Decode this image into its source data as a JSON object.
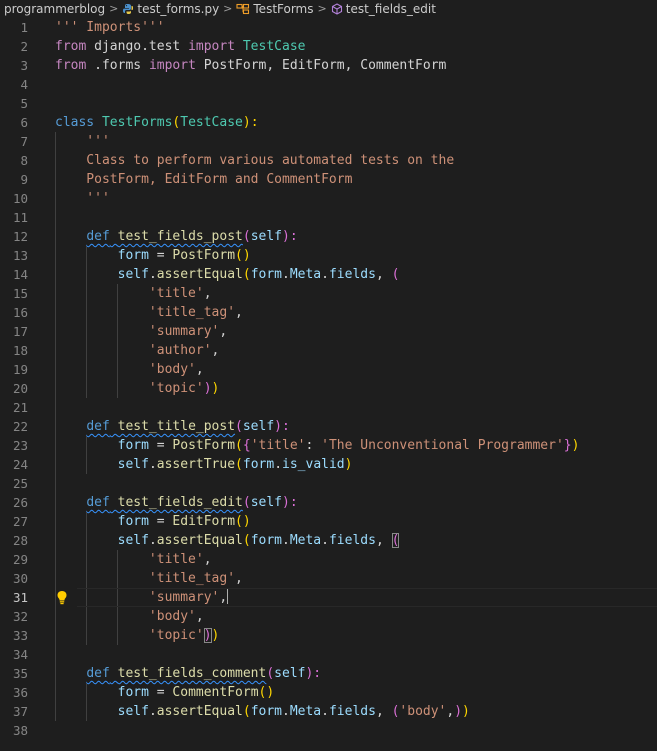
{
  "breadcrumb": {
    "folder": "programmerblog",
    "file": "test_forms.py",
    "class_name": "TestForms",
    "method_name": "test_fields_edit"
  },
  "editor": {
    "active_line": 31,
    "lines": [
      {
        "n": "1",
        "t": [
          {
            "s": "''' Imports'''",
            "c": "str"
          }
        ]
      },
      {
        "n": "2",
        "t": [
          {
            "s": "from",
            "c": "ctrl"
          },
          {
            "s": " django.test ",
            "c": "plain"
          },
          {
            "s": "import",
            "c": "ctrl"
          },
          {
            "s": " ",
            "c": "plain"
          },
          {
            "s": "TestCase",
            "c": "cls"
          }
        ]
      },
      {
        "n": "3",
        "t": [
          {
            "s": "from",
            "c": "ctrl"
          },
          {
            "s": " .forms ",
            "c": "plain"
          },
          {
            "s": "import",
            "c": "ctrl"
          },
          {
            "s": " PostForm, EditForm, CommentForm",
            "c": "plain"
          }
        ]
      },
      {
        "n": "4",
        "t": []
      },
      {
        "n": "5",
        "t": []
      },
      {
        "n": "6",
        "t": [
          {
            "s": "class",
            "c": "kw"
          },
          {
            "s": " ",
            "c": "plain"
          },
          {
            "s": "TestForms",
            "c": "cls"
          },
          {
            "s": "(",
            "c": "b1"
          },
          {
            "s": "TestCase",
            "c": "cls"
          },
          {
            "s": "):",
            "c": "b1"
          }
        ]
      },
      {
        "n": "7",
        "t": [
          {
            "s": "    '''",
            "c": "str"
          }
        ]
      },
      {
        "n": "8",
        "t": [
          {
            "s": "    Class to perform various automated tests on the",
            "c": "str"
          }
        ]
      },
      {
        "n": "9",
        "t": [
          {
            "s": "    PostForm, EditForm and CommentForm",
            "c": "str"
          }
        ]
      },
      {
        "n": "10",
        "t": [
          {
            "s": "    '''",
            "c": "str"
          }
        ]
      },
      {
        "n": "11",
        "t": []
      },
      {
        "n": "12",
        "t": [
          {
            "s": "    ",
            "c": "plain"
          },
          {
            "s": "def",
            "c": "kw",
            "sq": true
          },
          {
            "s": " ",
            "c": "plain",
            "sq": true
          },
          {
            "s": "test_fields_post",
            "c": "fn",
            "sq": true
          },
          {
            "s": "(",
            "c": "b2"
          },
          {
            "s": "self",
            "c": "var"
          },
          {
            "s": "):",
            "c": "b2"
          }
        ]
      },
      {
        "n": "13",
        "t": [
          {
            "s": "        ",
            "c": "plain"
          },
          {
            "s": "form",
            "c": "var"
          },
          {
            "s": " = ",
            "c": "plain"
          },
          {
            "s": "PostForm",
            "c": "fn"
          },
          {
            "s": "()",
            "c": "b1"
          }
        ]
      },
      {
        "n": "14",
        "t": [
          {
            "s": "        ",
            "c": "plain"
          },
          {
            "s": "self",
            "c": "var"
          },
          {
            "s": ".",
            "c": "plain"
          },
          {
            "s": "assertEqual",
            "c": "fn"
          },
          {
            "s": "(",
            "c": "b1"
          },
          {
            "s": "form",
            "c": "var"
          },
          {
            "s": ".",
            "c": "plain"
          },
          {
            "s": "Meta",
            "c": "var"
          },
          {
            "s": ".",
            "c": "plain"
          },
          {
            "s": "fields",
            "c": "var"
          },
          {
            "s": ", ",
            "c": "plain"
          },
          {
            "s": "(",
            "c": "b2"
          }
        ]
      },
      {
        "n": "15",
        "t": [
          {
            "s": "            ",
            "c": "plain"
          },
          {
            "s": "'title'",
            "c": "str"
          },
          {
            "s": ",",
            "c": "plain"
          }
        ]
      },
      {
        "n": "16",
        "t": [
          {
            "s": "            ",
            "c": "plain"
          },
          {
            "s": "'title_tag'",
            "c": "str"
          },
          {
            "s": ",",
            "c": "plain"
          }
        ]
      },
      {
        "n": "17",
        "t": [
          {
            "s": "            ",
            "c": "plain"
          },
          {
            "s": "'summary'",
            "c": "str"
          },
          {
            "s": ",",
            "c": "plain"
          }
        ]
      },
      {
        "n": "18",
        "t": [
          {
            "s": "            ",
            "c": "plain"
          },
          {
            "s": "'author'",
            "c": "str"
          },
          {
            "s": ",",
            "c": "plain"
          }
        ]
      },
      {
        "n": "19",
        "t": [
          {
            "s": "            ",
            "c": "plain"
          },
          {
            "s": "'body'",
            "c": "str"
          },
          {
            "s": ",",
            "c": "plain"
          }
        ]
      },
      {
        "n": "20",
        "t": [
          {
            "s": "            ",
            "c": "plain"
          },
          {
            "s": "'topic'",
            "c": "str"
          },
          {
            "s": ")",
            "c": "b2"
          },
          {
            "s": ")",
            "c": "b1"
          }
        ]
      },
      {
        "n": "21",
        "t": []
      },
      {
        "n": "22",
        "t": [
          {
            "s": "    ",
            "c": "plain"
          },
          {
            "s": "def",
            "c": "kw",
            "sq": true
          },
          {
            "s": " ",
            "c": "plain",
            "sq": true
          },
          {
            "s": "test_title_post",
            "c": "fn",
            "sq": true
          },
          {
            "s": "(",
            "c": "b2"
          },
          {
            "s": "self",
            "c": "var"
          },
          {
            "s": "):",
            "c": "b2"
          }
        ]
      },
      {
        "n": "23",
        "t": [
          {
            "s": "        ",
            "c": "plain"
          },
          {
            "s": "form",
            "c": "var"
          },
          {
            "s": " = ",
            "c": "plain"
          },
          {
            "s": "PostForm",
            "c": "fn"
          },
          {
            "s": "(",
            "c": "b1"
          },
          {
            "s": "{",
            "c": "b2"
          },
          {
            "s": "'title'",
            "c": "str"
          },
          {
            "s": ": ",
            "c": "plain"
          },
          {
            "s": "'The Unconventional Programmer'",
            "c": "str"
          },
          {
            "s": "}",
            "c": "b2"
          },
          {
            "s": ")",
            "c": "b1"
          }
        ]
      },
      {
        "n": "24",
        "t": [
          {
            "s": "        ",
            "c": "plain"
          },
          {
            "s": "self",
            "c": "var"
          },
          {
            "s": ".",
            "c": "plain"
          },
          {
            "s": "assertTrue",
            "c": "fn"
          },
          {
            "s": "(",
            "c": "b1"
          },
          {
            "s": "form",
            "c": "var"
          },
          {
            "s": ".",
            "c": "plain"
          },
          {
            "s": "is_valid",
            "c": "var"
          },
          {
            "s": ")",
            "c": "b1"
          }
        ]
      },
      {
        "n": "25",
        "t": []
      },
      {
        "n": "26",
        "t": [
          {
            "s": "    ",
            "c": "plain"
          },
          {
            "s": "def",
            "c": "kw",
            "sq": true
          },
          {
            "s": " ",
            "c": "plain",
            "sq": true
          },
          {
            "s": "test_fields_edit",
            "c": "fn",
            "sq": true
          },
          {
            "s": "(",
            "c": "b2"
          },
          {
            "s": "self",
            "c": "var"
          },
          {
            "s": "):",
            "c": "b2"
          }
        ]
      },
      {
        "n": "27",
        "t": [
          {
            "s": "        ",
            "c": "plain"
          },
          {
            "s": "form",
            "c": "var"
          },
          {
            "s": " = ",
            "c": "plain"
          },
          {
            "s": "EditForm",
            "c": "fn"
          },
          {
            "s": "()",
            "c": "b1"
          }
        ]
      },
      {
        "n": "28",
        "t": [
          {
            "s": "        ",
            "c": "plain"
          },
          {
            "s": "self",
            "c": "var"
          },
          {
            "s": ".",
            "c": "plain"
          },
          {
            "s": "assertEqual",
            "c": "fn"
          },
          {
            "s": "(",
            "c": "b1"
          },
          {
            "s": "form",
            "c": "var"
          },
          {
            "s": ".",
            "c": "plain"
          },
          {
            "s": "Meta",
            "c": "var"
          },
          {
            "s": ".",
            "c": "plain"
          },
          {
            "s": "fields",
            "c": "var"
          },
          {
            "s": ", ",
            "c": "plain"
          },
          {
            "s": "(",
            "c": "b2",
            "box": true
          }
        ]
      },
      {
        "n": "29",
        "t": [
          {
            "s": "            ",
            "c": "plain"
          },
          {
            "s": "'title'",
            "c": "str"
          },
          {
            "s": ",",
            "c": "plain"
          }
        ]
      },
      {
        "n": "30",
        "t": [
          {
            "s": "            ",
            "c": "plain"
          },
          {
            "s": "'title_tag'",
            "c": "str"
          },
          {
            "s": ",",
            "c": "plain"
          }
        ]
      },
      {
        "n": "31",
        "t": [
          {
            "s": "            ",
            "c": "plain"
          },
          {
            "s": "'summary'",
            "c": "str"
          },
          {
            "s": ",",
            "c": "plain"
          },
          {
            "cursor": true
          }
        ]
      },
      {
        "n": "32",
        "t": [
          {
            "s": "            ",
            "c": "plain"
          },
          {
            "s": "'body'",
            "c": "str"
          },
          {
            "s": ",",
            "c": "plain"
          }
        ]
      },
      {
        "n": "33",
        "t": [
          {
            "s": "            ",
            "c": "plain"
          },
          {
            "s": "'topic'",
            "c": "str"
          },
          {
            "s": ")",
            "c": "b2",
            "box": true
          },
          {
            "s": ")",
            "c": "b1"
          }
        ]
      },
      {
        "n": "34",
        "t": []
      },
      {
        "n": "35",
        "t": [
          {
            "s": "    ",
            "c": "plain"
          },
          {
            "s": "def",
            "c": "kw",
            "sq": true
          },
          {
            "s": " ",
            "c": "plain",
            "sq": true
          },
          {
            "s": "test_fields_comment",
            "c": "fn",
            "sq": true
          },
          {
            "s": "(",
            "c": "b2"
          },
          {
            "s": "self",
            "c": "var"
          },
          {
            "s": "):",
            "c": "b2"
          }
        ]
      },
      {
        "n": "36",
        "t": [
          {
            "s": "        ",
            "c": "plain"
          },
          {
            "s": "form",
            "c": "var"
          },
          {
            "s": " = ",
            "c": "plain"
          },
          {
            "s": "CommentForm",
            "c": "fn"
          },
          {
            "s": "()",
            "c": "b1"
          }
        ]
      },
      {
        "n": "37",
        "t": [
          {
            "s": "        ",
            "c": "plain"
          },
          {
            "s": "self",
            "c": "var"
          },
          {
            "s": ".",
            "c": "plain"
          },
          {
            "s": "assertEqual",
            "c": "fn"
          },
          {
            "s": "(",
            "c": "b1"
          },
          {
            "s": "form",
            "c": "var"
          },
          {
            "s": ".",
            "c": "plain"
          },
          {
            "s": "Meta",
            "c": "var"
          },
          {
            "s": ".",
            "c": "plain"
          },
          {
            "s": "fields",
            "c": "var"
          },
          {
            "s": ", ",
            "c": "plain"
          },
          {
            "s": "(",
            "c": "b2"
          },
          {
            "s": "'body'",
            "c": "str"
          },
          {
            "s": ",",
            "c": "plain"
          },
          {
            "s": ")",
            "c": "b2"
          },
          {
            "s": ")",
            "c": "b1"
          }
        ]
      },
      {
        "n": "38",
        "t": []
      }
    ]
  }
}
